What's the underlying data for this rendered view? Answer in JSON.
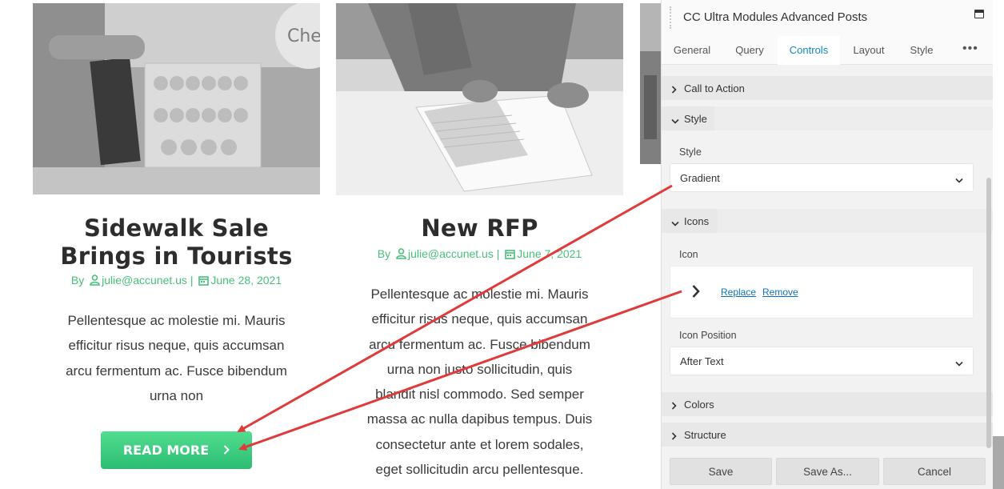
{
  "cards": [
    {
      "title_lines": [
        "Sidewalk Sale",
        "Brings in Tourists"
      ],
      "meta_by": "By",
      "meta_author": "julie@accunet.us",
      "meta_sep": "|",
      "meta_date": "June 28, 2021",
      "excerpt_lines": [
        "Pellentesque ac molestie mi. Mauris",
        "efficitur risus neque, quis accumsan",
        "arcu fermentum ac. Fusce bibendum",
        "urna non"
      ],
      "button_label": "READ MORE",
      "image_icon": "macaron-stand-photo"
    },
    {
      "title_lines": [
        "New RFP"
      ],
      "meta_by": "By",
      "meta_author": "julie@accunet.us",
      "meta_sep": "|",
      "meta_date": "June 7, 2021",
      "excerpt_lines": [
        "Pellentesque ac molestie mi. Mauris",
        "efficitur risus neque, quis accumsan",
        "arcu fermentum ac. Fusce bibendum",
        "urna non justo sollicitudin, quis",
        "blandit nisl commodo. Sed semper",
        "massa ac nulla dapibus tempus. Duis",
        "consectetur ante et lorem sodales,",
        "eget sollicitudin arcu pellentesque."
      ],
      "image_icon": "worker-clipboard-photo"
    }
  ],
  "panel": {
    "title": "CC Ultra Modules Advanced Posts",
    "tabs": [
      "General",
      "Query",
      "Controls",
      "Layout",
      "Style"
    ],
    "active_tab": "Controls",
    "sections": {
      "call_to_action": "Call to Action",
      "style": "Style",
      "icons": "Icons",
      "colors": "Colors",
      "structure": "Structure"
    },
    "fields": {
      "style_label": "Style",
      "style_value": "Gradient",
      "icon_label": "Icon",
      "icon_replace": "Replace",
      "icon_remove": "Remove",
      "icon_position_label": "Icon Position",
      "icon_position_value": "After Text"
    },
    "footer": {
      "save": "Save",
      "save_as": "Save As...",
      "cancel": "Cancel"
    }
  },
  "colors": {
    "accent_green": "#47c079",
    "button_gradient_top": "#52dd8f",
    "button_gradient_bottom": "#2bbd73",
    "active_tab_blue": "#0e8ac4",
    "arrow_red": "#e03a3a"
  }
}
